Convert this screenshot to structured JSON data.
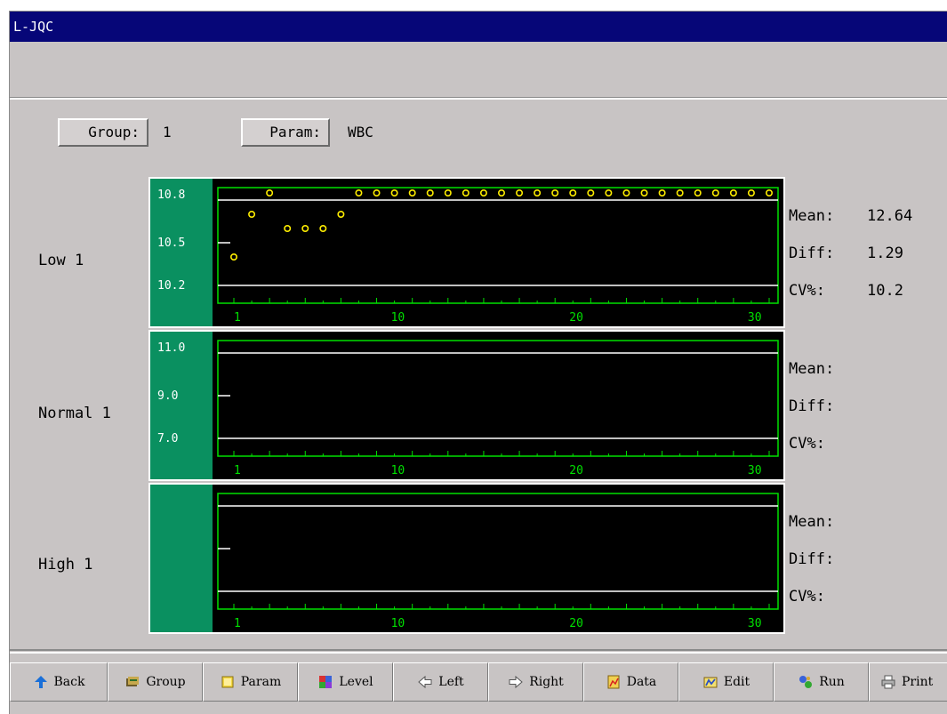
{
  "window": {
    "title": "L-JQC"
  },
  "selectors": {
    "group_label": "Group:",
    "group_value": "1",
    "param_label": "Param:",
    "param_value": "WBC"
  },
  "levels": [
    {
      "label": "Low 1",
      "y_ticks": [
        "10.8",
        "10.5",
        "10.2"
      ],
      "stats": {
        "mean_label": "Mean:",
        "mean": "12.64",
        "diff_label": "Diff:",
        "diff": "1.29",
        "cv_label": "CV%:",
        "cv": "10.2"
      },
      "points": [
        {
          "x": 1,
          "y": 10.4
        },
        {
          "x": 2,
          "y": 10.7
        },
        {
          "x": 3,
          "y": 10.85
        },
        {
          "x": 4,
          "y": 10.6
        },
        {
          "x": 5,
          "y": 10.6
        },
        {
          "x": 6,
          "y": 10.6
        },
        {
          "x": 7,
          "y": 10.7
        },
        {
          "x": 8,
          "y": 10.85
        },
        {
          "x": 9,
          "y": 10.85
        },
        {
          "x": 10,
          "y": 10.85
        },
        {
          "x": 11,
          "y": 10.85
        },
        {
          "x": 12,
          "y": 10.85
        },
        {
          "x": 13,
          "y": 10.85
        },
        {
          "x": 14,
          "y": 10.85
        },
        {
          "x": 15,
          "y": 10.85
        },
        {
          "x": 16,
          "y": 10.85
        },
        {
          "x": 17,
          "y": 10.85
        },
        {
          "x": 18,
          "y": 10.85
        },
        {
          "x": 19,
          "y": 10.85
        },
        {
          "x": 20,
          "y": 10.85
        },
        {
          "x": 21,
          "y": 10.85
        },
        {
          "x": 22,
          "y": 10.85
        },
        {
          "x": 23,
          "y": 10.85
        },
        {
          "x": 24,
          "y": 10.85
        },
        {
          "x": 25,
          "y": 10.85
        },
        {
          "x": 26,
          "y": 10.85
        },
        {
          "x": 27,
          "y": 10.85
        },
        {
          "x": 28,
          "y": 10.85
        },
        {
          "x": 29,
          "y": 10.85
        },
        {
          "x": 30,
          "y": 10.85
        },
        {
          "x": 31,
          "y": 10.85
        }
      ]
    },
    {
      "label": "Normal 1",
      "y_ticks": [
        "11.0",
        "9.0",
        "7.0"
      ],
      "stats": {
        "mean_label": "Mean:",
        "mean": "",
        "diff_label": "Diff:",
        "diff": "",
        "cv_label": "CV%:",
        "cv": ""
      },
      "points": []
    },
    {
      "label": "High 1",
      "y_ticks": [
        "",
        "",
        ""
      ],
      "stats": {
        "mean_label": "Mean:",
        "mean": "",
        "diff_label": "Diff:",
        "diff": "",
        "cv_label": "CV%:",
        "cv": ""
      },
      "points": []
    }
  ],
  "x_ticks": [
    "1",
    "10",
    "20",
    "30"
  ],
  "x_max": 31,
  "colors": {
    "plot_bg": "#000000",
    "axis": "#00e000",
    "tick_panel": "#0a9060",
    "limit_line": "#ffffff",
    "point": "#ffee00",
    "title_bg": "#060678"
  },
  "toolbar": [
    {
      "label": "Back",
      "icon": "back-arrow-icon"
    },
    {
      "label": "Group",
      "icon": "group-icon"
    },
    {
      "label": "Param",
      "icon": "param-icon"
    },
    {
      "label": "Level",
      "icon": "level-icon"
    },
    {
      "label": "Left",
      "icon": "left-arrow-icon"
    },
    {
      "label": "Right",
      "icon": "right-arrow-icon"
    },
    {
      "label": "Data",
      "icon": "data-icon"
    },
    {
      "label": "Edit",
      "icon": "edit-icon"
    },
    {
      "label": "Run",
      "icon": "run-icon"
    },
    {
      "label": "Print",
      "icon": "print-icon"
    }
  ]
}
